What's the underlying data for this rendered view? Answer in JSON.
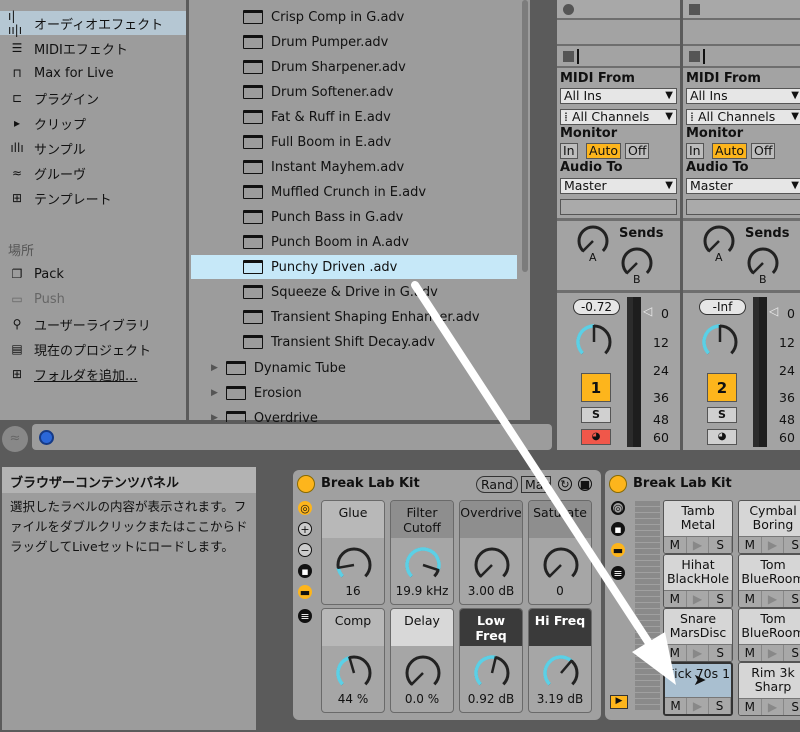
{
  "sidebar": {
    "categories": [
      {
        "label": "オーディオエフェクト",
        "icon": "waveform-icon",
        "selected": true
      },
      {
        "label": "MIDIエフェクト",
        "icon": "midi-effect-icon"
      },
      {
        "label": "Max for Live",
        "icon": "max-for-live-icon"
      },
      {
        "label": "プラグイン",
        "icon": "plugin-icon"
      },
      {
        "label": "クリップ",
        "icon": "clip-icon"
      },
      {
        "label": "サンプル",
        "icon": "sample-icon"
      },
      {
        "label": "グルーヴ",
        "icon": "groove-icon"
      },
      {
        "label": "テンプレート",
        "icon": "template-icon"
      }
    ],
    "places_heading": "場所",
    "places": [
      {
        "label": "Pack",
        "icon": "pack-icon"
      },
      {
        "label": "Push",
        "icon": "push-icon",
        "disabled": true
      },
      {
        "label": "ユーザーライブラリ",
        "icon": "user-icon"
      },
      {
        "label": "現在のプロジェクト",
        "icon": "project-folder-icon"
      },
      {
        "label": "フォルダを追加...",
        "icon": "add-folder-icon",
        "link": true
      }
    ]
  },
  "files": [
    "Crisp Comp in G.adv",
    "Drum Pumper.adv",
    "Drum Sharpener.adv",
    "Drum Softener.adv",
    "Fat & Ruff in E.adv",
    "Full Boom in E.adv",
    "Instant Mayhem.adv",
    "Muffled Crunch in E.adv",
    "Punch Bass in G.adv",
    "Punch Boom in A.adv",
    "Punchy Driven .adv",
    "Squeeze & Drive in G.adv",
    "Transient Shaping Enhancer.adv",
    "Transient Shift Decay.adv"
  ],
  "selected_file": "Punchy Driven .adv",
  "folders": [
    "Dynamic Tube",
    "Erosion",
    "Overdrive"
  ],
  "info_panel": {
    "title": "ブラウザーコンテンツパネル",
    "body": "選択したラベルの内容が表示されます。ファイルをダブルクリックまたはここからドラッグしてLiveセットにロードします。"
  },
  "mixer": {
    "labels": {
      "midi_from": "MIDI From",
      "monitor": "Monitor",
      "audio_to": "Audio To",
      "sends": "Sends",
      "send_a": "A",
      "send_b": "B",
      "solo": "S"
    },
    "tracks": [
      {
        "midi_from": "All Ins",
        "channel": "All Channels",
        "monitor": [
          "In",
          "Auto",
          "Off"
        ],
        "monitor_active": "Auto",
        "audio_to": "Master",
        "volume": "-0.72",
        "number": "1",
        "arm_active": true
      },
      {
        "midi_from": "All Ins",
        "channel": "All Channels",
        "monitor": [
          "In",
          "Auto",
          "Off"
        ],
        "monitor_active": "Auto",
        "audio_to": "Master",
        "volume": "-Inf",
        "number": "2",
        "arm_active": false
      }
    ],
    "meter_scale": [
      "0",
      "12",
      "24",
      "36",
      "48",
      "60"
    ]
  },
  "rack": {
    "title": "Break Lab Kit",
    "rand_label": "Rand",
    "map_label": "Map",
    "macros": [
      {
        "name": "Glue",
        "value": "16",
        "fill": 0.13,
        "style": "normal"
      },
      {
        "name": "Filter Cutoff",
        "value": "19.9 kHz",
        "fill": 0.9,
        "style": "mid"
      },
      {
        "name": "Overdrive",
        "value": "3.00 dB",
        "fill": 0.0,
        "style": "mid"
      },
      {
        "name": "Saturate",
        "value": "0",
        "fill": 0.0,
        "style": "mid"
      },
      {
        "name": "Comp",
        "value": "44 %",
        "fill": 0.44,
        "style": "normal"
      },
      {
        "name": "Delay",
        "value": "0.0 %",
        "fill": 0.0,
        "style": "light"
      },
      {
        "name": "Low Freq",
        "value": "0.92 dB",
        "fill": 0.55,
        "style": "dark"
      },
      {
        "name": "Hi Freq",
        "value": "3.19 dB",
        "fill": 0.65,
        "style": "dark"
      }
    ]
  },
  "drum_rack": {
    "title": "Break Lab Kit",
    "pads": [
      {
        "name": "Tamb Metal"
      },
      {
        "name": "Cymbal Boring"
      },
      {
        "name": "Hihat BlackHole"
      },
      {
        "name": "Tom BlueRoom"
      },
      {
        "name": "Snare MarsDisc"
      },
      {
        "name": "Tom BlueRoom"
      },
      {
        "name": "Kick 70s 1",
        "selected": true
      },
      {
        "name": "Rim 3k Sharp"
      }
    ],
    "mute_label": "M",
    "solo_label": "S"
  },
  "colors": {
    "accent": "#fdb51c",
    "selection": "#c6e8f8",
    "knob_arc": "#5bd0e6",
    "arm": "#f0574a"
  }
}
